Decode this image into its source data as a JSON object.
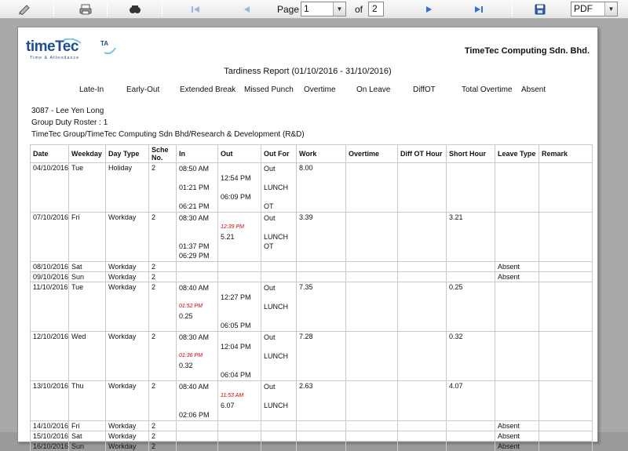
{
  "toolbar": {
    "page_label": "Page",
    "page_value": "1",
    "of_label": "of",
    "total_pages": "2",
    "export_format": "PDF"
  },
  "report": {
    "company": "TimeTec Computing Sdn. Bhd.",
    "logo_text": "timeTec",
    "logo_superscript": "TA",
    "logo_tagline": "Time & Attendance",
    "title": "Tardiness Report  (01/10/2016 - 31/10/2016)",
    "legend": [
      "Late-In",
      "Early-Out",
      "Extended Break",
      "Missed Punch",
      "Overtime",
      "On Leave",
      "DiffOT",
      "Total Overtime",
      "Absent"
    ],
    "employee": "3087 - Lee Yen Long",
    "duty_roster": "Group Duty Roster : 1",
    "department": "TimeTec Group/TimeTec Computing Sdn Bhd/Research & Development (R&D)"
  },
  "table": {
    "headers": [
      "Date",
      "Weekday",
      "Day Type",
      "Sche No.",
      "In",
      "Out",
      "Out For",
      "Work",
      "Overtime",
      "Diff OT Hour",
      "Short Hour",
      "Leave Type",
      "Remark"
    ],
    "rows": [
      {
        "date": "04/10/2016",
        "weekday": "Tue",
        "daytype": "Holiday",
        "sche": "2",
        "work": "8.00",
        "short": "",
        "leave": "",
        "punches": [
          [
            "08:50 AM",
            "",
            "Out"
          ],
          [
            "",
            "12:54 PM",
            ""
          ],
          [
            "01:21 PM",
            "",
            "LUNCH"
          ],
          [
            "",
            "06:09 PM",
            ""
          ],
          [
            "06:21 PM",
            "",
            "OT"
          ]
        ]
      },
      {
        "date": "07/10/2016",
        "weekday": "Fri",
        "daytype": "Workday",
        "sche": "2",
        "work": "3.39",
        "short": "3.21",
        "leave": "",
        "punches": [
          [
            "08:30 AM",
            "",
            "Out"
          ],
          [
            "",
            "12:39 PM|5.21",
            ""
          ],
          [
            "01:37 PM",
            "",
            "LUNCH"
          ],
          [
            "06:29 PM",
            "",
            "OT"
          ]
        ]
      },
      {
        "date": "08/10/2016",
        "weekday": "Sat",
        "daytype": "Workday",
        "sche": "2",
        "work": "",
        "short": "",
        "leave": "Absent",
        "punches": []
      },
      {
        "date": "09/10/2016",
        "weekday": "Sun",
        "daytype": "Workday",
        "sche": "2",
        "work": "",
        "short": "",
        "leave": "Absent",
        "punches": []
      },
      {
        "date": "11/10/2016",
        "weekday": "Tue",
        "daytype": "Workday",
        "sche": "2",
        "work": "7.35",
        "short": "0.25",
        "leave": "",
        "punches": [
          [
            "08:40 AM",
            "",
            "Out"
          ],
          [
            "",
            "12:27 PM",
            ""
          ],
          [
            "01:52 PM|0.25",
            "",
            "LUNCH"
          ],
          [
            "",
            "06:05 PM",
            ""
          ]
        ]
      },
      {
        "date": "12/10/2016",
        "weekday": "Wed",
        "daytype": "Workday",
        "sche": "2",
        "work": "7.28",
        "short": "0.32",
        "leave": "",
        "punches": [
          [
            "08:30 AM",
            "",
            "Out"
          ],
          [
            "",
            "12:04 PM",
            ""
          ],
          [
            "01:36 PM|0.32",
            "",
            "LUNCH"
          ],
          [
            "",
            "06:04 PM",
            ""
          ]
        ]
      },
      {
        "date": "13/10/2016",
        "weekday": "Thu",
        "daytype": "Workday",
        "sche": "2",
        "work": "2.63",
        "short": "4.07",
        "leave": "",
        "punches": [
          [
            "08:40 AM",
            "",
            "Out"
          ],
          [
            "",
            "11:53 AM|6.07",
            ""
          ],
          [
            "02:06 PM",
            "",
            "LUNCH"
          ]
        ]
      },
      {
        "date": "14/10/2016",
        "weekday": "Fri",
        "daytype": "Workday",
        "sche": "2",
        "work": "",
        "short": "",
        "leave": "Absent",
        "punches": []
      },
      {
        "date": "15/10/2016",
        "weekday": "Sat",
        "daytype": "Workday",
        "sche": "2",
        "work": "",
        "short": "",
        "leave": "Absent",
        "punches": []
      },
      {
        "date": "16/10/2016",
        "weekday": "Sun",
        "daytype": "Workday",
        "sche": "2",
        "work": "",
        "short": "",
        "leave": "Absent",
        "punches": []
      }
    ]
  },
  "colors": {
    "late": "#d00000",
    "toolbar_icon": "#2f6fd6"
  }
}
